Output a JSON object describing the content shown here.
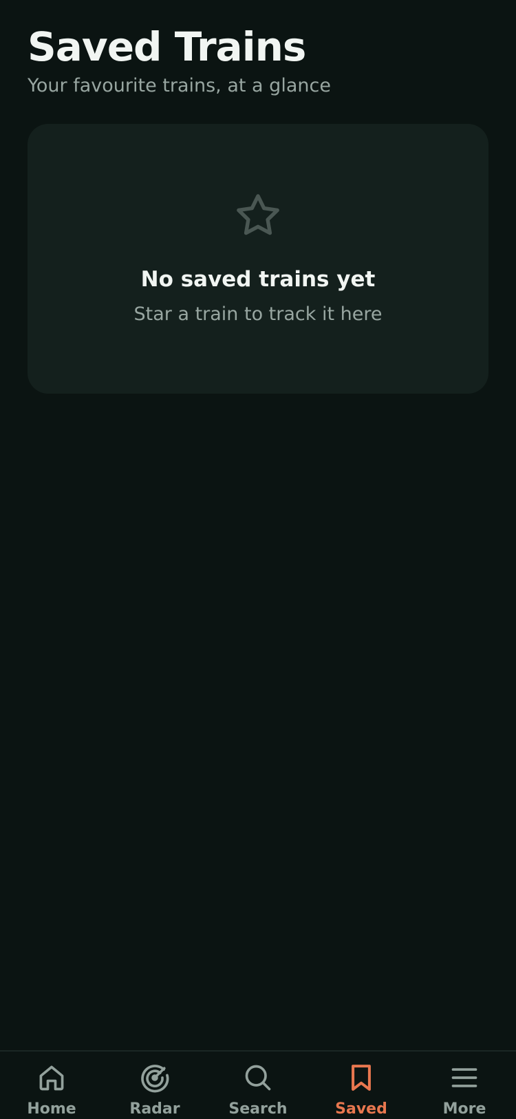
{
  "header": {
    "title": "Saved Trains",
    "subtitle": "Your favourite trains, at a glance"
  },
  "empty_state": {
    "icon": "star-icon",
    "title": "No saved trains yet",
    "message": "Star a train to track it here"
  },
  "tabbar": {
    "active": "saved",
    "active_color": "#e8774f",
    "inactive_color": "#93a19c",
    "tabs": [
      {
        "id": "home",
        "label": "Home",
        "icon": "home-icon"
      },
      {
        "id": "radar",
        "label": "Radar",
        "icon": "radar-icon"
      },
      {
        "id": "search",
        "label": "Search",
        "icon": "search-icon"
      },
      {
        "id": "saved",
        "label": "Saved",
        "icon": "bookmark-icon"
      },
      {
        "id": "more",
        "label": "More",
        "icon": "menu-icon"
      }
    ]
  }
}
